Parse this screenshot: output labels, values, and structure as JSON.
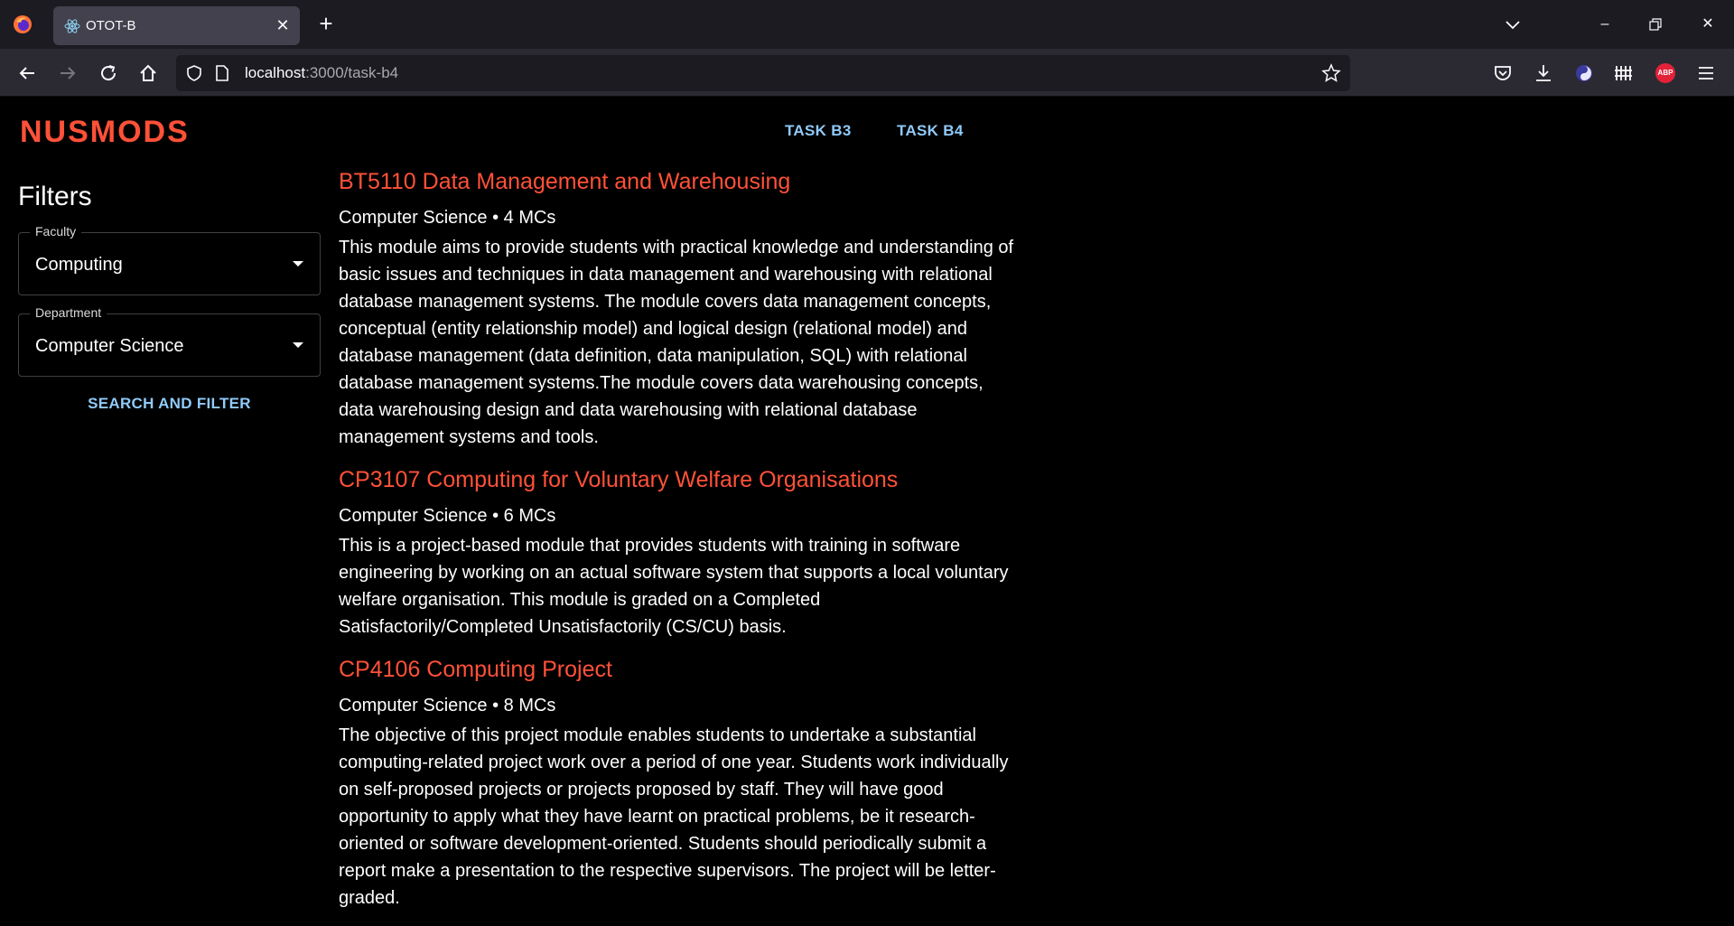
{
  "browser": {
    "tab_title": "OTOT-B",
    "url_host": "localhost",
    "url_rest": ":3000/task-b4",
    "abp_label": "ABP"
  },
  "app": {
    "logo": "NUSMODS",
    "nav": [
      {
        "label": "TASK B3"
      },
      {
        "label": "TASK B4"
      }
    ]
  },
  "filters": {
    "title": "Filters",
    "faculty": {
      "label": "Faculty",
      "value": "Computing"
    },
    "department": {
      "label": "Department",
      "value": "Computer Science"
    },
    "search_button": "SEARCH AND FILTER"
  },
  "modules": [
    {
      "title": "BT5110 Data Management and Warehousing",
      "meta": "Computer Science • 4 MCs",
      "description": "This module aims to provide students with practical knowledge and understanding of basic issues and techniques in data management and warehousing with relational database management systems. The module covers data management concepts, conceptual (entity relationship model) and logical design (relational model) and database management (data definition, data manipulation, SQL) with relational database management systems.The module covers data warehousing concepts, data warehousing design and data warehousing with relational database management systems and tools."
    },
    {
      "title": "CP3107 Computing for Voluntary Welfare Organisations",
      "meta": "Computer Science • 6 MCs",
      "description": "This is a project-based module that provides students with training in software engineering by working on an actual software system that supports a local voluntary welfare organisation. This module is graded on a Completed Satisfactorily/Completed Unsatisfactorily (CS/CU) basis."
    },
    {
      "title": "CP4106 Computing Project",
      "meta": "Computer Science • 8 MCs",
      "description": "The objective of this project module enables students to undertake a substantial computing-related project work over a period of one year. Students work individually on self-proposed projects or projects proposed by staff. They will have good opportunity to apply what they have learnt on practical problems, be it research-oriented or software development-oriented. Students should periodically submit a report make a presentation to the respective supervisors. The project will be letter-graded."
    }
  ]
}
